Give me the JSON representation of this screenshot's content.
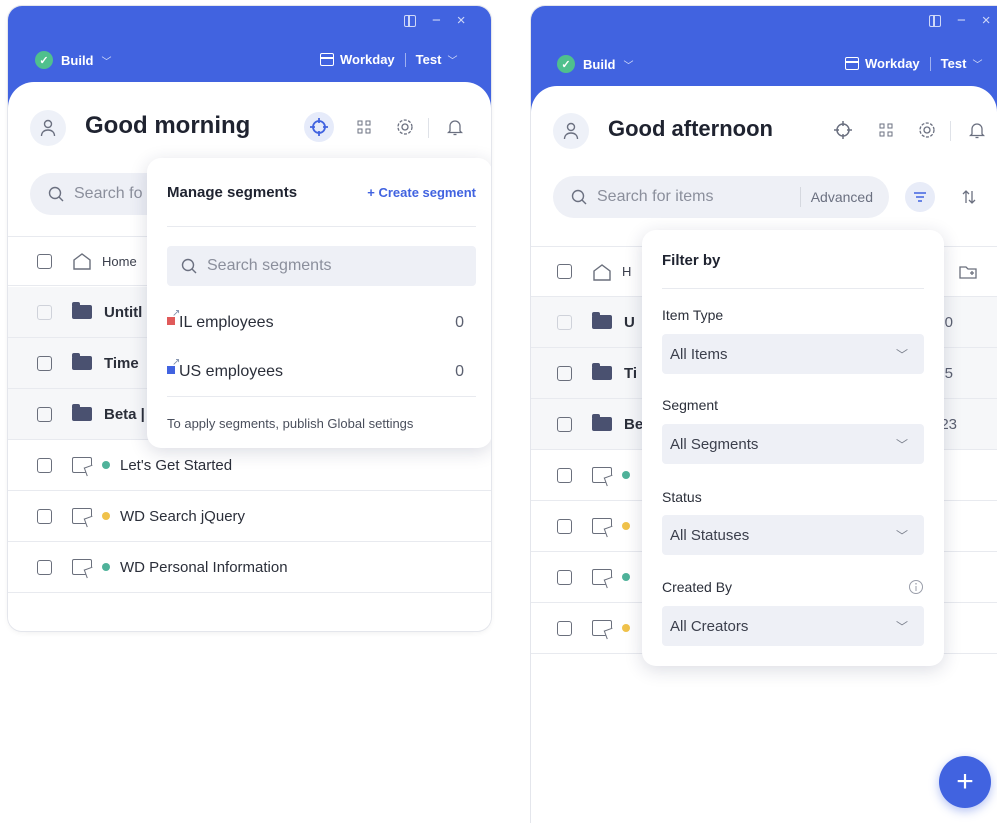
{
  "left": {
    "window_controls": [
      "▯",
      "−",
      "×"
    ],
    "build_label": "Build",
    "env_label": "Workday",
    "env_mode": "Test",
    "greeting": "Good morning",
    "search_placeholder": "Search fo",
    "rows": [
      {
        "label": "Home",
        "type": "home"
      },
      {
        "label": "Untitl",
        "type": "folder"
      },
      {
        "label": "Time",
        "type": "folder"
      },
      {
        "label": "Beta |",
        "type": "folder"
      },
      {
        "label": "Let's Get Started",
        "type": "flow",
        "status_color": "#4fb29a"
      },
      {
        "label": "WD Search jQuery",
        "type": "flow",
        "status_color": "#f0c24b"
      },
      {
        "label": "WD Personal Information",
        "type": "flow",
        "status_color": "#4fb29a"
      }
    ],
    "segments_popup": {
      "title": "Manage segments",
      "create_label": "+ Create segment",
      "search_placeholder": "Search segments",
      "segments": [
        {
          "name": "IL employees",
          "count": "0",
          "color": "#e05a5a"
        },
        {
          "name": "US employees",
          "count": "0",
          "color": "#4163e0"
        }
      ],
      "footer": "To apply segments, publish Global settings"
    }
  },
  "right": {
    "window_controls": [
      "▯",
      "−",
      "×"
    ],
    "build_label": "Build",
    "env_label": "Workday",
    "env_mode": "Test",
    "greeting": "Good afternoon",
    "search_placeholder": "Search for items",
    "advanced_label": "Advanced",
    "rows": [
      {
        "label": "H",
        "type": "home"
      },
      {
        "label": "U",
        "type": "folder",
        "trail": "0"
      },
      {
        "label": "Ti",
        "type": "folder",
        "trail": "5"
      },
      {
        "label": "Be",
        "type": "folder",
        "trail": "23"
      },
      {
        "label": "",
        "type": "flow",
        "status_color": "#4fb29a"
      },
      {
        "label": "",
        "type": "flow",
        "status_color": "#f0c24b"
      },
      {
        "label": "",
        "type": "flow",
        "status_color": "#4fb29a"
      },
      {
        "label": "",
        "type": "flow",
        "status_color": "#f0c24b"
      }
    ],
    "filter_popup": {
      "title": "Filter by",
      "filters": [
        {
          "label": "Item Type",
          "value": "All Items"
        },
        {
          "label": "Segment",
          "value": "All Segments"
        },
        {
          "label": "Status",
          "value": "All Statuses"
        },
        {
          "label": "Created By",
          "value": "All Creators"
        }
      ]
    },
    "fab_label": "+"
  }
}
